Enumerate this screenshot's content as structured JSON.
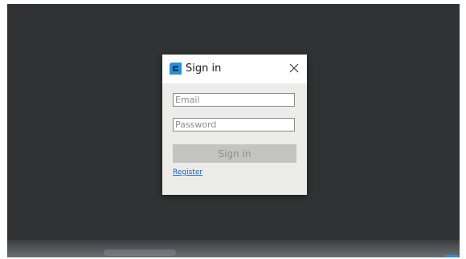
{
  "dialog": {
    "title": "Sign in",
    "logo_icon": "app-logo-icon",
    "close_icon": "close-icon"
  },
  "form": {
    "email_placeholder": "Email",
    "email_value": "",
    "password_placeholder": "Password",
    "password_value": "",
    "signin_label": "Sign in",
    "register_label": "Register"
  },
  "colors": {
    "backdrop": "#303233",
    "dialog_bg": "#ececea",
    "logo": "#2a8fd4",
    "button_disabled": "#c3c3c2",
    "link": "#1f5fb8"
  }
}
